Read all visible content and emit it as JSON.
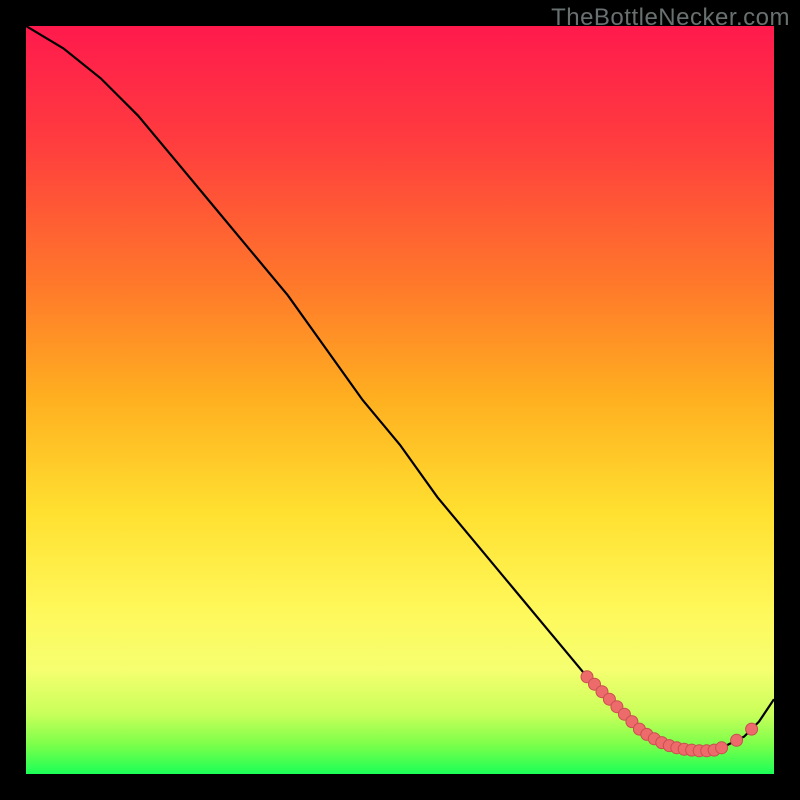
{
  "watermark": "TheBottleNecker.com",
  "colors": {
    "curve": "#000000",
    "dot_fill": "#ed6b6b",
    "dot_stroke": "#c94f4f"
  },
  "chart_data": {
    "type": "line",
    "title": "",
    "xlabel": "",
    "ylabel": "",
    "xlim": [
      0,
      100
    ],
    "ylim": [
      0,
      100
    ],
    "series": [
      {
        "name": "curve",
        "x": [
          0,
          5,
          10,
          15,
          20,
          25,
          30,
          35,
          40,
          45,
          50,
          55,
          60,
          65,
          70,
          75,
          78,
          80,
          82,
          84,
          86,
          88,
          90,
          92,
          94,
          96,
          98,
          100
        ],
        "y": [
          100,
          97,
          93,
          88,
          82,
          76,
          70,
          64,
          57,
          50,
          44,
          37,
          31,
          25,
          19,
          13,
          10,
          8,
          6,
          5,
          4,
          3,
          3,
          3,
          4,
          5,
          7,
          10
        ]
      }
    ],
    "markers": [
      {
        "x": 75,
        "y": 13
      },
      {
        "x": 76,
        "y": 12
      },
      {
        "x": 77,
        "y": 11
      },
      {
        "x": 78,
        "y": 10
      },
      {
        "x": 79,
        "y": 9
      },
      {
        "x": 80,
        "y": 8
      },
      {
        "x": 81,
        "y": 7
      },
      {
        "x": 82,
        "y": 6
      },
      {
        "x": 83,
        "y": 5.3
      },
      {
        "x": 84,
        "y": 4.7
      },
      {
        "x": 85,
        "y": 4.2
      },
      {
        "x": 86,
        "y": 3.8
      },
      {
        "x": 87,
        "y": 3.5
      },
      {
        "x": 88,
        "y": 3.3
      },
      {
        "x": 89,
        "y": 3.2
      },
      {
        "x": 90,
        "y": 3.1
      },
      {
        "x": 91,
        "y": 3.1
      },
      {
        "x": 92,
        "y": 3.2
      },
      {
        "x": 93,
        "y": 3.5
      },
      {
        "x": 95,
        "y": 4.5
      },
      {
        "x": 97,
        "y": 6
      }
    ]
  }
}
